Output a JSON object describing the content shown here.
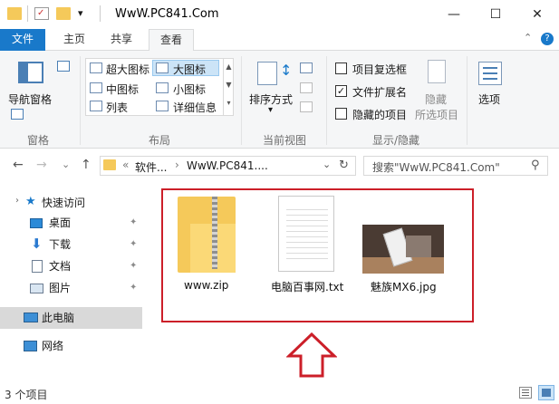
{
  "window": {
    "title": "WwW.PC841.Com",
    "minimize_glyph": "—",
    "maximize_glyph": "☐",
    "close_glyph": "✕",
    "dropdown_glyph": "▾"
  },
  "tabs": [
    {
      "label": "文件"
    },
    {
      "label": "主页"
    },
    {
      "label": "共享"
    },
    {
      "label": "查看"
    }
  ],
  "ribbon": {
    "collapse_glyph": "⌃",
    "help_glyph": "?",
    "panes": {
      "nav_pane": "导航窗格",
      "group": "窗格"
    },
    "layout": {
      "extra_large": "超大图标",
      "large": "大图标",
      "medium": "中图标",
      "small": "小图标",
      "list": "列表",
      "details": "详细信息",
      "group": "布局"
    },
    "current_view": {
      "sort_by": "排序方式",
      "group": "当前视图"
    },
    "show_hide": {
      "item_checkboxes": {
        "label": "项目复选框",
        "checked": false
      },
      "file_extensions": {
        "label": "文件扩展名",
        "checked": true
      },
      "hidden_items": {
        "label": "隐藏的项目",
        "checked": false
      },
      "hide_selected_line1": "隐藏",
      "hide_selected_line2": "所选项目",
      "options": "选项",
      "group": "显示/隐藏"
    }
  },
  "addressbar": {
    "back_glyph": "←",
    "forward_glyph": "→",
    "dropdown_glyph": "⌄",
    "up_glyph": "↑",
    "overflow_glyph": "«",
    "crumb_1": "软件...",
    "crumb_sep": "›",
    "crumb_2": "WwW.PC841....",
    "refresh_glyph": "↻",
    "search_placeholder": "搜索\"WwW.PC841.Com\"",
    "search_glyph": "⚲"
  },
  "navpane": {
    "quick_access": "快速访问",
    "desktop": "桌面",
    "downloads": "下载",
    "documents": "文档",
    "pictures": "图片",
    "this_pc": "此电脑",
    "network": "网络",
    "pin_glyph": "📌"
  },
  "files": [
    {
      "name": "www.zip",
      "type": "zip-folder"
    },
    {
      "name": "电脑百事网.txt",
      "type": "text-file"
    },
    {
      "name": "魅族MX6.jpg",
      "type": "image-file"
    }
  ],
  "status": {
    "count": "3 个项目"
  },
  "colors": {
    "accent": "#1979ca",
    "highlight": "#cc1f29",
    "folder": "#f5c95a"
  }
}
